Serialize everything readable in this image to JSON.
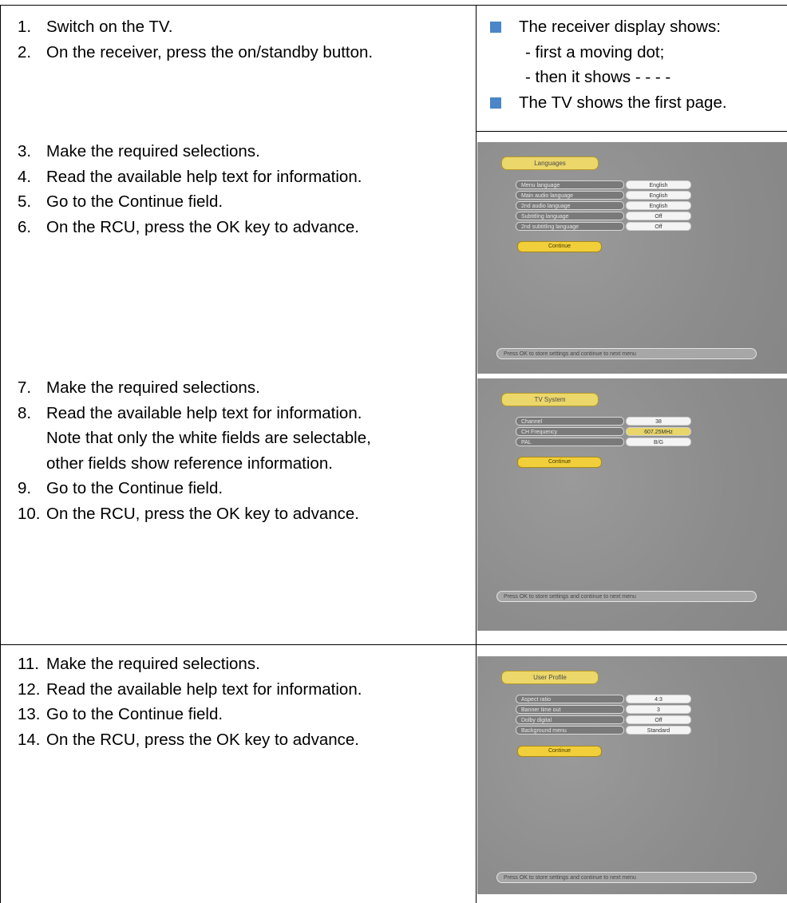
{
  "section1": {
    "steps": [
      {
        "num": "1.",
        "text": "Switch on the TV."
      },
      {
        "num": "2.",
        "text": "On the receiver, press the on/standby button."
      }
    ],
    "notes": {
      "display": "The receiver display shows:",
      "sub1": "- first a moving dot;",
      "sub2": "- then it shows - - - -",
      "tv": "The TV shows the first page."
    }
  },
  "section2": {
    "steps": [
      {
        "num": "3.",
        "text": "Make the required selections."
      },
      {
        "num": "4.",
        "text": "Read the available help text for information."
      },
      {
        "num": "5.",
        "text": "Go to the Continue field."
      },
      {
        "num": "6.",
        "text": "On the RCU, press the OK key to advance."
      }
    ],
    "screen": {
      "title": "Languages",
      "rows": [
        {
          "label": "Menu language",
          "value": "English"
        },
        {
          "label": "Main audio language",
          "value": "English"
        },
        {
          "label": "2nd audio language",
          "value": "English"
        },
        {
          "label": "Subtitling language",
          "value": "Off"
        },
        {
          "label": "2nd subtitling language",
          "value": "Off"
        }
      ],
      "button": "Continue",
      "help": "Press OK to store settings and continue to next menu"
    }
  },
  "section3": {
    "steps": [
      {
        "num": "7.",
        "text": "Make the required selections."
      },
      {
        "num": "8.",
        "text": "Read the available help text for information.",
        "cont1": "Note that only the white fields are selectable,",
        "cont2": "other fields show reference information."
      },
      {
        "num": "9.",
        "text": "Go to the Continue field."
      },
      {
        "num": "10.",
        "text": "On the RCU, press the OK key to advance."
      }
    ],
    "screen": {
      "title": "TV System",
      "rows": [
        {
          "label": "Channel",
          "value": "38"
        },
        {
          "label": "CH Frequency",
          "value": "607.25MHz"
        },
        {
          "label": "PAL",
          "value": "B/G"
        }
      ],
      "button": "Continue",
      "help": "Press OK to store settings and continue to next menu"
    }
  },
  "section4": {
    "steps": [
      {
        "num": "11.",
        "text": "Make the required selections."
      },
      {
        "num": "12.",
        "text": "Read the available help text for information."
      },
      {
        "num": "13.",
        "text": "Go to the Continue field."
      },
      {
        "num": "14.",
        "text": "On the RCU, press the OK key to advance."
      }
    ],
    "screen": {
      "title": "User Profile",
      "rows": [
        {
          "label": "Aspect ratio",
          "value": "4:3"
        },
        {
          "label": "Banner time out",
          "value": "3"
        },
        {
          "label": "Dolby digital",
          "value": "Off"
        },
        {
          "label": "Background menu",
          "value": "Standard"
        }
      ],
      "button": "Continue",
      "help": "Press OK to store settings and continue to next menu"
    }
  },
  "colors": {
    "bullet": "#4a86c8",
    "screen_bg": "#8f8f8f",
    "highlight": "#f0cf3a"
  }
}
